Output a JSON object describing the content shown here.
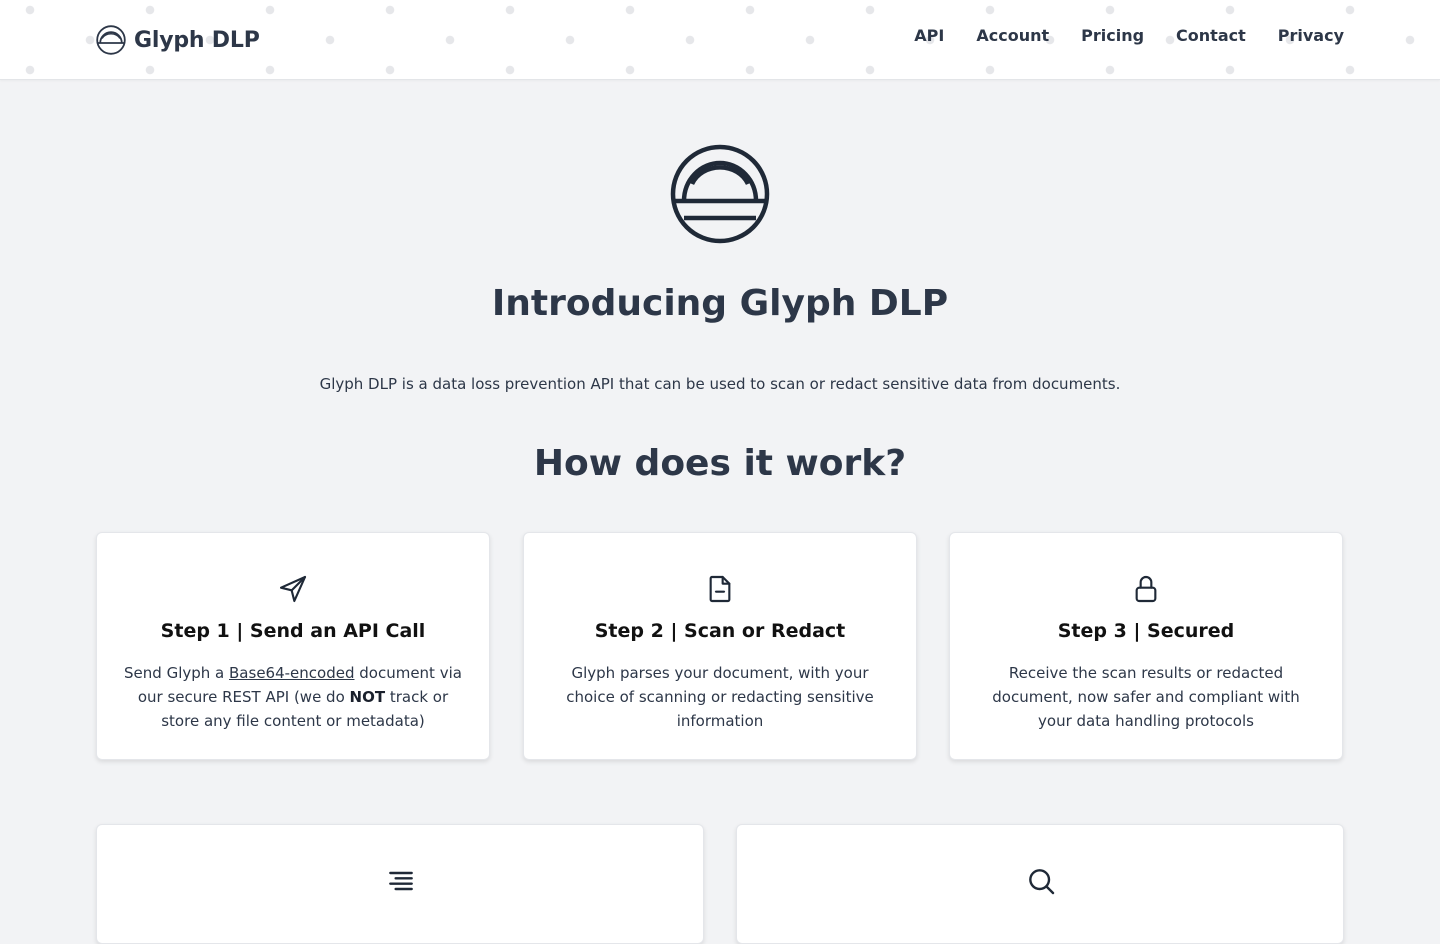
{
  "brand": {
    "name": "Glyph DLP",
    "logo_icon": "glyph-dome-icon"
  },
  "nav": {
    "items": [
      {
        "label": "API"
      },
      {
        "label": "Account"
      },
      {
        "label": "Pricing"
      },
      {
        "label": "Contact"
      },
      {
        "label": "Privacy"
      }
    ]
  },
  "hero": {
    "logo_icon": "glyph-dome-icon",
    "title": "Introducing Glyph DLP",
    "description": "Glyph DLP is a data loss prevention API that can be used to scan or redact sensitive data from documents."
  },
  "how": {
    "title": "How does it work?",
    "steps": [
      {
        "icon": "send-icon",
        "title": "Step 1 | Send an API Call",
        "text_before": "Send Glyph a ",
        "text_link": "Base64-encoded",
        "text_mid": " document via our secure REST API (we do ",
        "text_bold": "NOT",
        "text_after": " track or store any file content or metadata)"
      },
      {
        "icon": "document-icon",
        "title": "Step 2 | Scan or Redact",
        "text": "Glyph parses your document, with your choice of scanning or redacting sensitive information"
      },
      {
        "icon": "lock-icon",
        "title": "Step 3 | Secured",
        "text": "Receive the scan results or redacted document, now safer and compliant with your data handling protocols"
      }
    ]
  },
  "features": [
    {
      "icon": "align-right-icon"
    },
    {
      "icon": "search-icon"
    }
  ],
  "colors": {
    "background": "#f2f3f5",
    "text": "#2d3748",
    "card": "#ffffff"
  }
}
